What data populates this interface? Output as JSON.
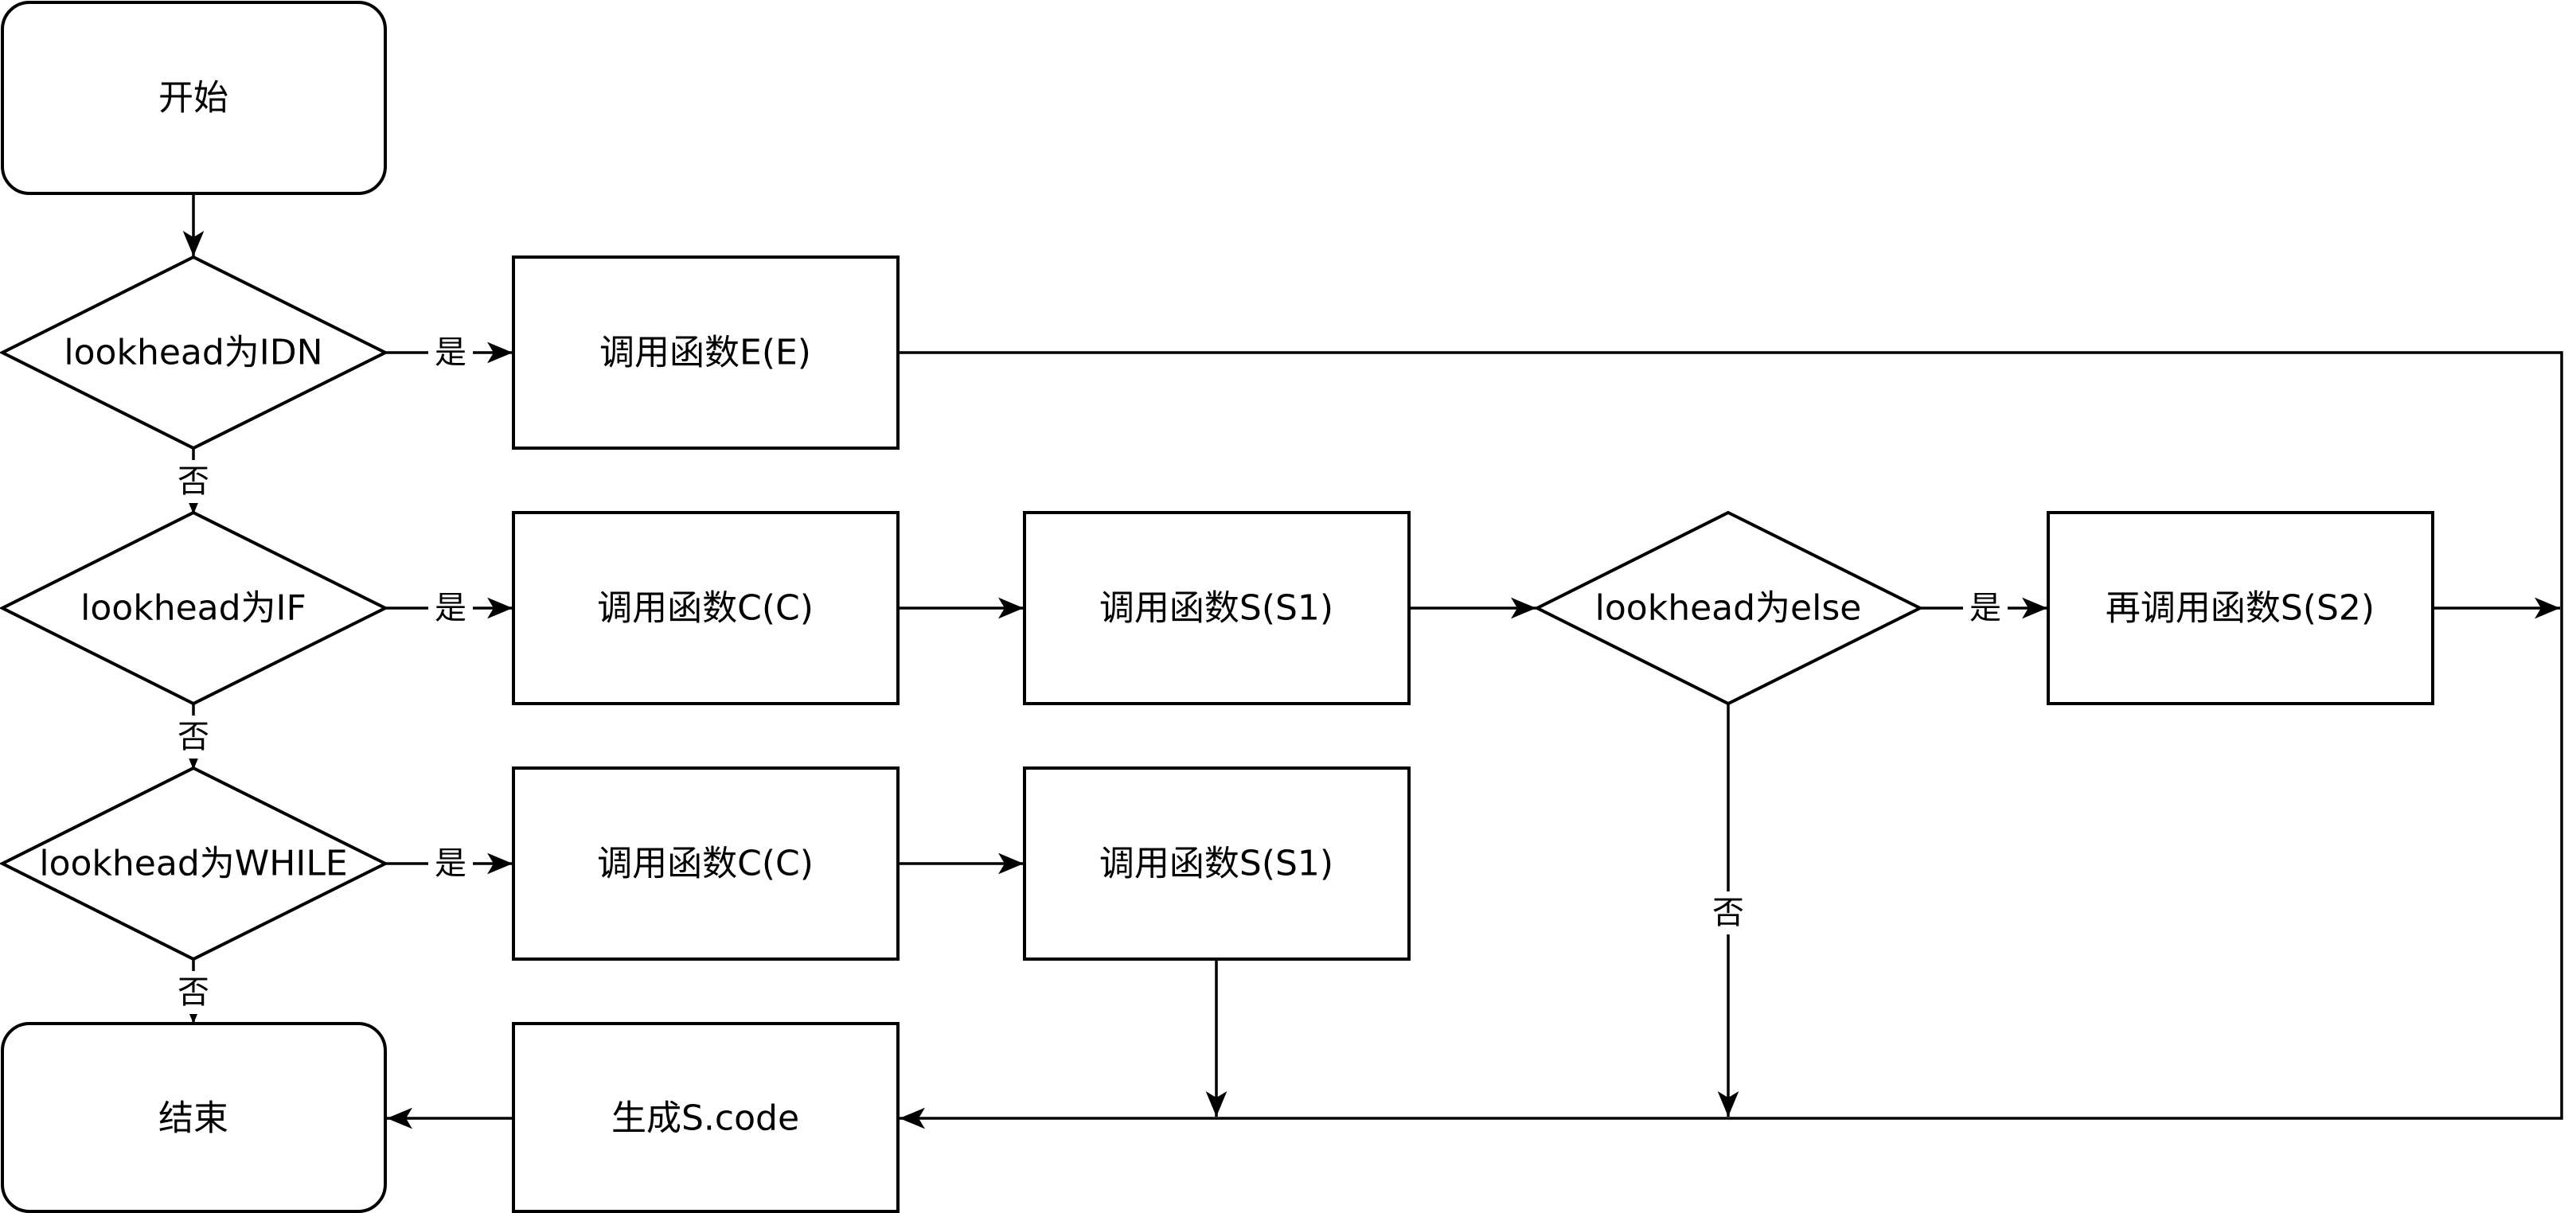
{
  "nodes": {
    "start": "开始",
    "d_idn": "lookhead为IDN",
    "call_e": "调用函数E(E)",
    "d_if": "lookhead为IF",
    "if_call_c": "调用函数C(C)",
    "if_call_s1": "调用函数S(S1)",
    "d_else": "lookhead为else",
    "call_s2": "再调用函数S(S2)",
    "d_while": "lookhead为WHILE",
    "while_call_c": "调用函数C(C)",
    "while_call_s1": "调用函数S(S1)",
    "gen_code": "生成S.code",
    "end": "结束"
  },
  "edge_labels": {
    "idn_yes": "是",
    "idn_no": "否",
    "if_yes": "是",
    "if_no": "否",
    "else_yes": "是",
    "else_no": "否",
    "while_yes": "是",
    "while_no": "否"
  }
}
